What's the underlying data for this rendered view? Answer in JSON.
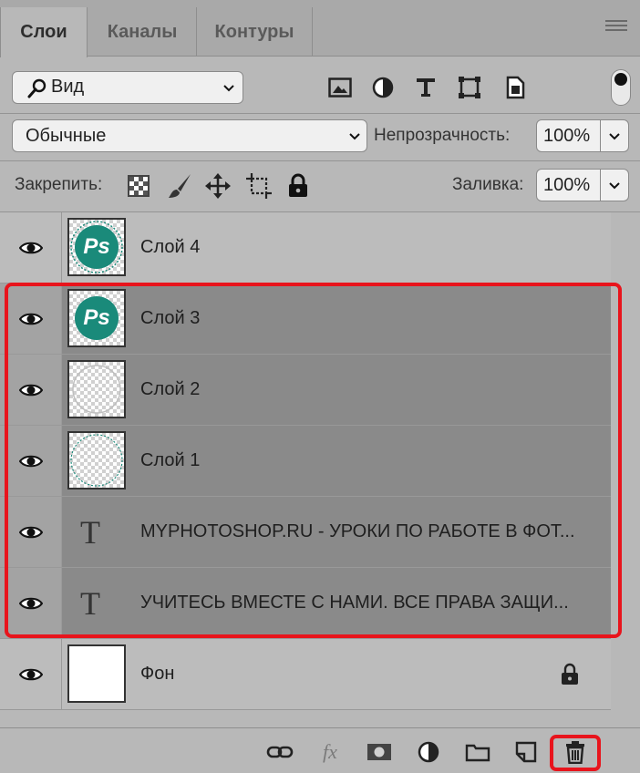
{
  "tabs": [
    {
      "label": "Слои",
      "active": true
    },
    {
      "label": "Каналы",
      "active": false
    },
    {
      "label": "Контуры",
      "active": false
    }
  ],
  "filter": {
    "kind_label": "Вид",
    "icons": [
      "image-filter-icon",
      "adjustment-filter-icon",
      "type-filter-icon",
      "shape-filter-icon",
      "smart-object-filter-icon"
    ]
  },
  "blend": {
    "mode": "Обычные",
    "opacity_label": "Непрозрачность:",
    "opacity_value": "100%"
  },
  "lock": {
    "label": "Закрепить:",
    "fill_label": "Заливка:",
    "fill_value": "100%"
  },
  "layers": [
    {
      "name": "Слой 4",
      "thumb": "ps-logo",
      "selected": false
    },
    {
      "name": "Слой 3",
      "thumb": "ps-logo",
      "selected": true
    },
    {
      "name": "Слой 2",
      "thumb": "ring",
      "selected": true
    },
    {
      "name": "Слой 1",
      "thumb": "ring",
      "selected": true
    },
    {
      "name": "MYPHOTOSHOP.RU - УРОКИ ПО РАБОТЕ В ФОТ...",
      "thumb": "type",
      "selected": true
    },
    {
      "name": "УЧИТЕСЬ ВМЕСТЕ С НАМИ. ВСЕ ПРАВА ЗАЩИ...",
      "thumb": "type",
      "selected": true
    },
    {
      "name": "Фон",
      "thumb": "white",
      "selected": false,
      "locked": true
    }
  ],
  "logo_text": "Ps",
  "type_glyph": "T",
  "bottom_bar": [
    "link-layers-icon",
    "fx-icon",
    "add-mask-icon",
    "new-adjustment-icon",
    "new-group-icon",
    "new-layer-icon",
    "delete-layer-icon"
  ],
  "fx_text": "fx",
  "colors": {
    "panel": "#b8b8b8",
    "selected_row": "#8a8a8a",
    "highlight": "#e8141c",
    "logo_teal": "#1a8a7a"
  }
}
